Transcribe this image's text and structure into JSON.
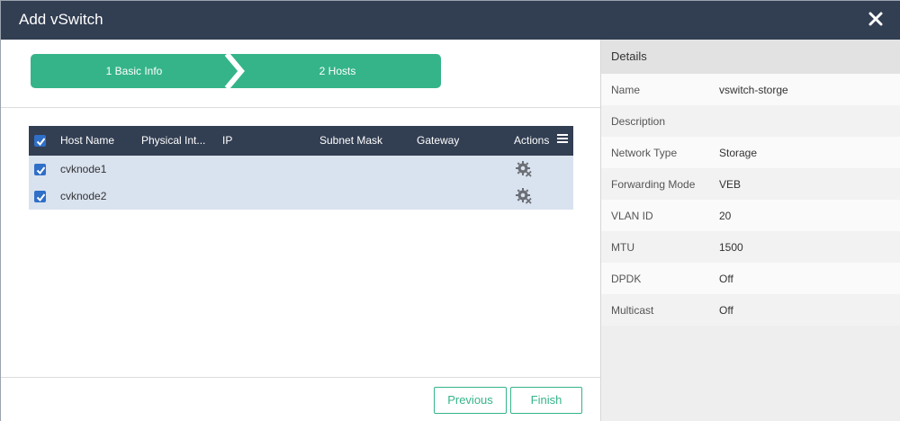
{
  "dialog": {
    "title": "Add vSwitch"
  },
  "stepper": {
    "steps": [
      {
        "label": "1 Basic Info"
      },
      {
        "label": "2 Hosts"
      }
    ]
  },
  "table": {
    "columns": {
      "host_name": "Host Name",
      "physical_interface": "Physical Int...",
      "ip": "IP",
      "subnet_mask": "Subnet Mask",
      "gateway": "Gateway",
      "actions": "Actions"
    },
    "rows": [
      {
        "host_name": "cvknode1",
        "checked": true,
        "action_icon": "gear-remove-icon"
      },
      {
        "host_name": "cvknode2",
        "checked": true,
        "action_icon": "gear-remove-icon"
      }
    ],
    "select_all_checked": true
  },
  "footer": {
    "previous_label": "Previous",
    "finish_label": "Finish"
  },
  "details": {
    "header": "Details",
    "items": [
      {
        "key": "Name",
        "value": "vswitch-storge"
      },
      {
        "key": "Description",
        "value": ""
      },
      {
        "key": "Network Type",
        "value": "Storage"
      },
      {
        "key": "Forwarding Mode",
        "value": "VEB"
      },
      {
        "key": "VLAN ID",
        "value": "20"
      },
      {
        "key": "MTU",
        "value": "1500"
      },
      {
        "key": "DPDK",
        "value": "Off"
      },
      {
        "key": "Multicast",
        "value": "Off"
      }
    ]
  },
  "colors": {
    "titlebar": "#323e52",
    "accent": "#35b48a",
    "checkbox": "#2f6fc8",
    "row_bg": "#d9e2ef"
  }
}
